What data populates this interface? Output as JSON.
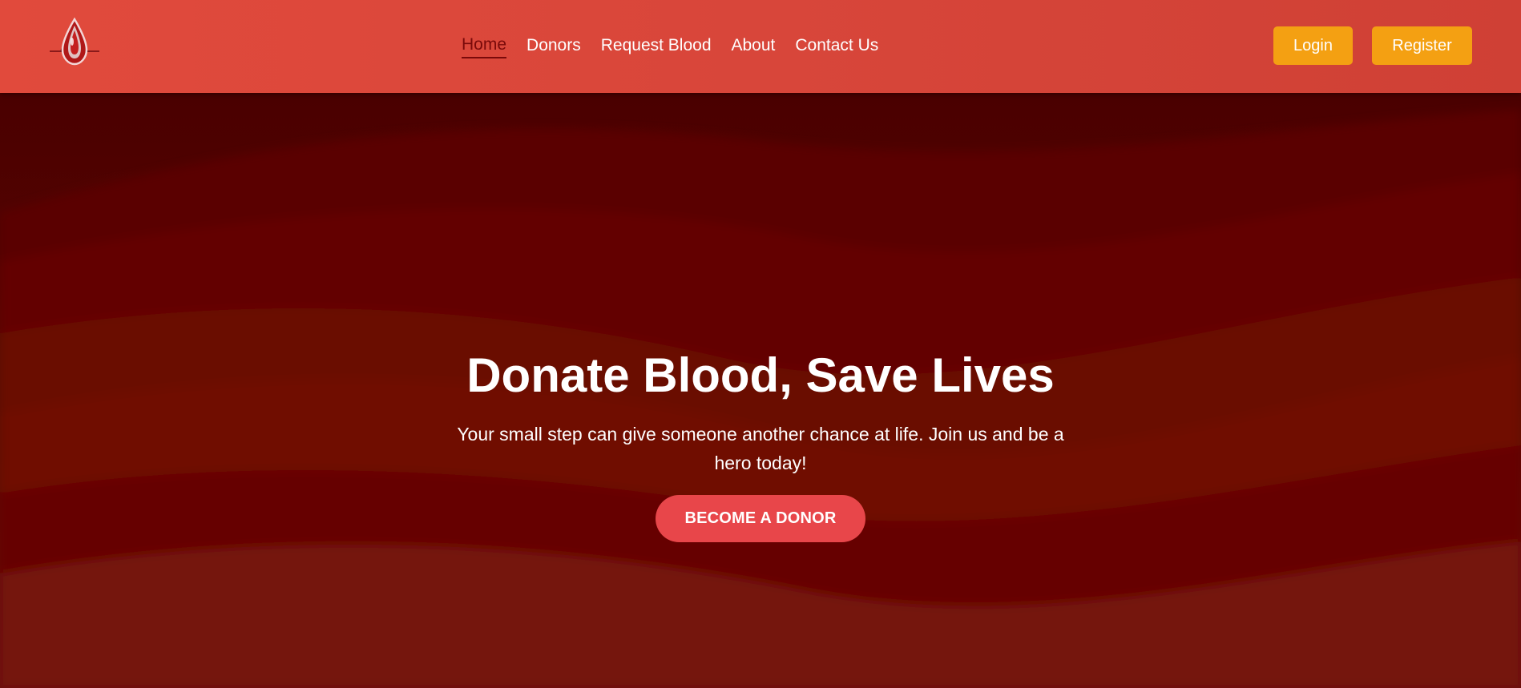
{
  "header": {
    "logo_icon": "blood-drop-heartbeat-icon",
    "nav": [
      {
        "label": "Home",
        "active": true
      },
      {
        "label": "Donors",
        "active": false
      },
      {
        "label": "Request Blood",
        "active": false
      },
      {
        "label": "About",
        "active": false
      },
      {
        "label": "Contact Us",
        "active": false
      }
    ],
    "login_label": "Login",
    "register_label": "Register"
  },
  "hero": {
    "title": "Donate Blood, Save Lives",
    "subtitle": "Your small step can give someone another chance at life. Join us and be a hero today!",
    "cta_label": "BECOME A DONOR"
  },
  "colors": {
    "header_bg": "#dc463a",
    "nav_active": "#7a0a0a",
    "accent_buttons": "#f4a012",
    "cta": "#e8464a",
    "hero_bg": "#5a0000"
  }
}
